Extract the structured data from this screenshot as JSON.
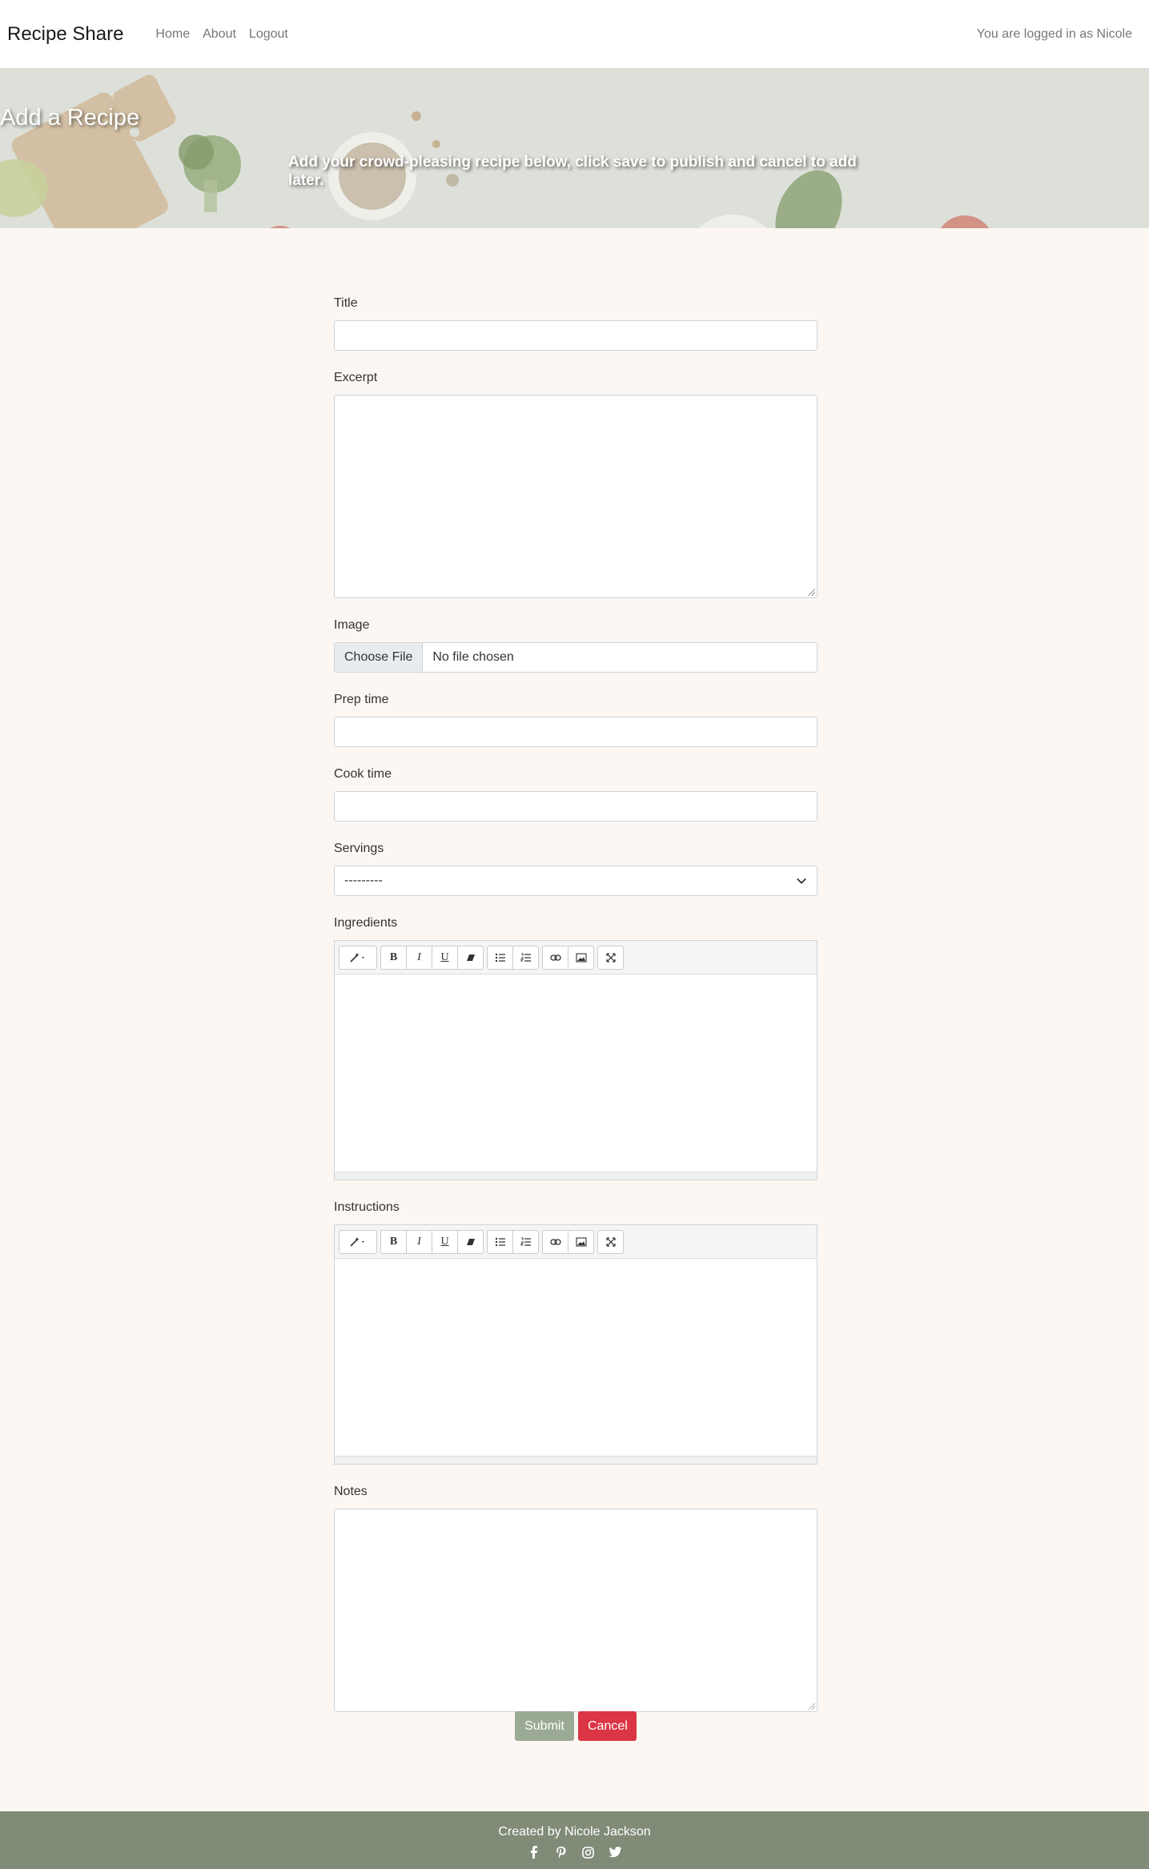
{
  "navbar": {
    "brand": "Recipe Share",
    "links": [
      "Home",
      "About",
      "Logout"
    ],
    "user_text": "You are logged in as Nicole"
  },
  "hero": {
    "title": "Add a Recipe",
    "subtitle": "Add your crowd-pleasing recipe below, click save to publish and cancel to add later."
  },
  "form": {
    "title_label": "Title",
    "title_value": "",
    "excerpt_label": "Excerpt",
    "excerpt_value": "",
    "image_label": "Image",
    "file_button": "Choose File",
    "file_status": "No file chosen",
    "prep_label": "Prep time",
    "prep_value": "",
    "cook_label": "Cook time",
    "cook_value": "",
    "servings_label": "Servings",
    "servings_selected": "---------",
    "ingredients_label": "Ingredients",
    "instructions_label": "Instructions",
    "notes_label": "Notes",
    "notes_value": ""
  },
  "editor_toolbar": {
    "style": "style-icon",
    "bold": "B",
    "italic": "I",
    "underline": "U",
    "clear": "eraser-icon",
    "ul": "unordered-list-icon",
    "ol": "ordered-list-icon",
    "link": "link-icon",
    "picture": "picture-icon",
    "fullscreen": "fullscreen-icon"
  },
  "buttons": {
    "submit": "Submit",
    "cancel": "Cancel"
  },
  "footer": {
    "text": "Created by Nicole Jackson",
    "social": [
      "facebook-icon",
      "pinterest-icon",
      "instagram-icon",
      "twitter-icon"
    ]
  },
  "colors": {
    "page_bg": "#fcf7f2",
    "footer_bg": "#808b78",
    "submit_bg": "#9aaa94",
    "cancel_bg": "#dc3545"
  }
}
